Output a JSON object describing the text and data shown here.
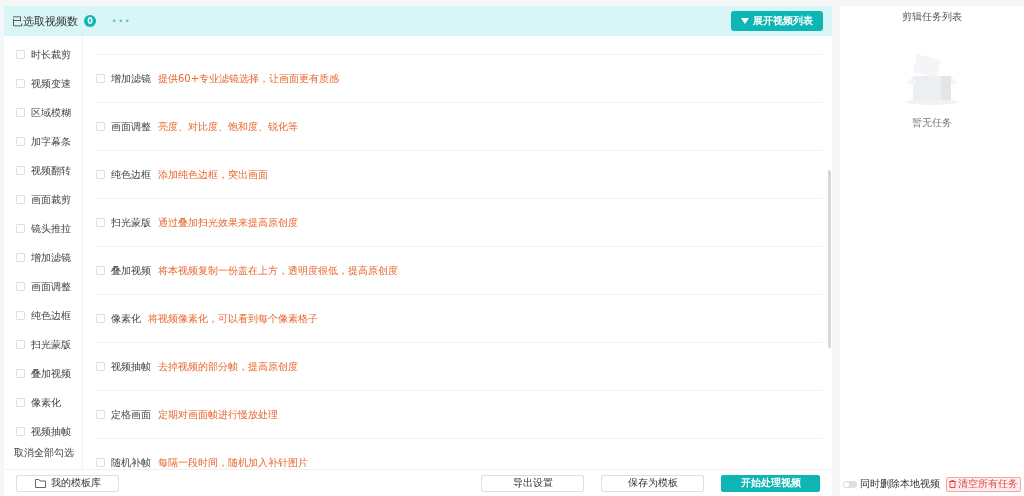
{
  "header": {
    "title": "已选取视频数",
    "count": "0",
    "more": "···",
    "expand_button": "展开视频列表"
  },
  "sidebar": {
    "items": [
      {
        "label": "时长裁剪",
        "checked": false
      },
      {
        "label": "视频变速",
        "checked": false
      },
      {
        "label": "区域模糊",
        "checked": false
      },
      {
        "label": "加字幕条",
        "checked": false
      },
      {
        "label": "视频翻转",
        "checked": false
      },
      {
        "label": "画面裁剪",
        "checked": false
      },
      {
        "label": "镜头推拉",
        "checked": false
      },
      {
        "label": "增加滤镜",
        "checked": false
      },
      {
        "label": "画面调整",
        "checked": false
      },
      {
        "label": "纯色边框",
        "checked": false
      },
      {
        "label": "扫光蒙版",
        "checked": false
      },
      {
        "label": "叠加视频",
        "checked": false
      },
      {
        "label": "像素化",
        "checked": false
      },
      {
        "label": "视频抽帧",
        "checked": false
      }
    ],
    "clear_link": "取消全部勾选"
  },
  "effects": [
    {
      "label": "增加滤镜",
      "description": "提供60+专业滤镜选择，让画面更有质感",
      "checked": false
    },
    {
      "label": "画面调整",
      "description": "亮度、对比度、饱和度、锐化等",
      "checked": false
    },
    {
      "label": "纯色边框",
      "description": "添加纯色边框，突出画面",
      "checked": false
    },
    {
      "label": "扫光蒙版",
      "description": "通过叠加扫光效果来提高原创度",
      "checked": false
    },
    {
      "label": "叠加视频",
      "description": "将本视频复制一份盖在上方，透明度很低，提高原创度",
      "checked": false
    },
    {
      "label": "像素化",
      "description": "将视频像素化，可以看到每个像素格子",
      "checked": false
    },
    {
      "label": "视频抽帧",
      "description": "去掉视频的部分帧，提高原创度",
      "checked": false
    },
    {
      "label": "定格画面",
      "description": "定期对画面帧进行慢放处理",
      "checked": false
    },
    {
      "label": "随机补帧",
      "description": "每隔一段时间，随机加入补针图片",
      "checked": false
    }
  ],
  "footer": {
    "template_library": "我的模板库",
    "export_settings": "导出设置",
    "save_template": "保存为模板",
    "start": "开始处理视频"
  },
  "task_panel": {
    "title": "剪辑任务列表",
    "empty": "暂无任务",
    "delete_local": {
      "label": "同时删除本地视频",
      "on": false
    },
    "clear_all": "清空所有任务"
  }
}
